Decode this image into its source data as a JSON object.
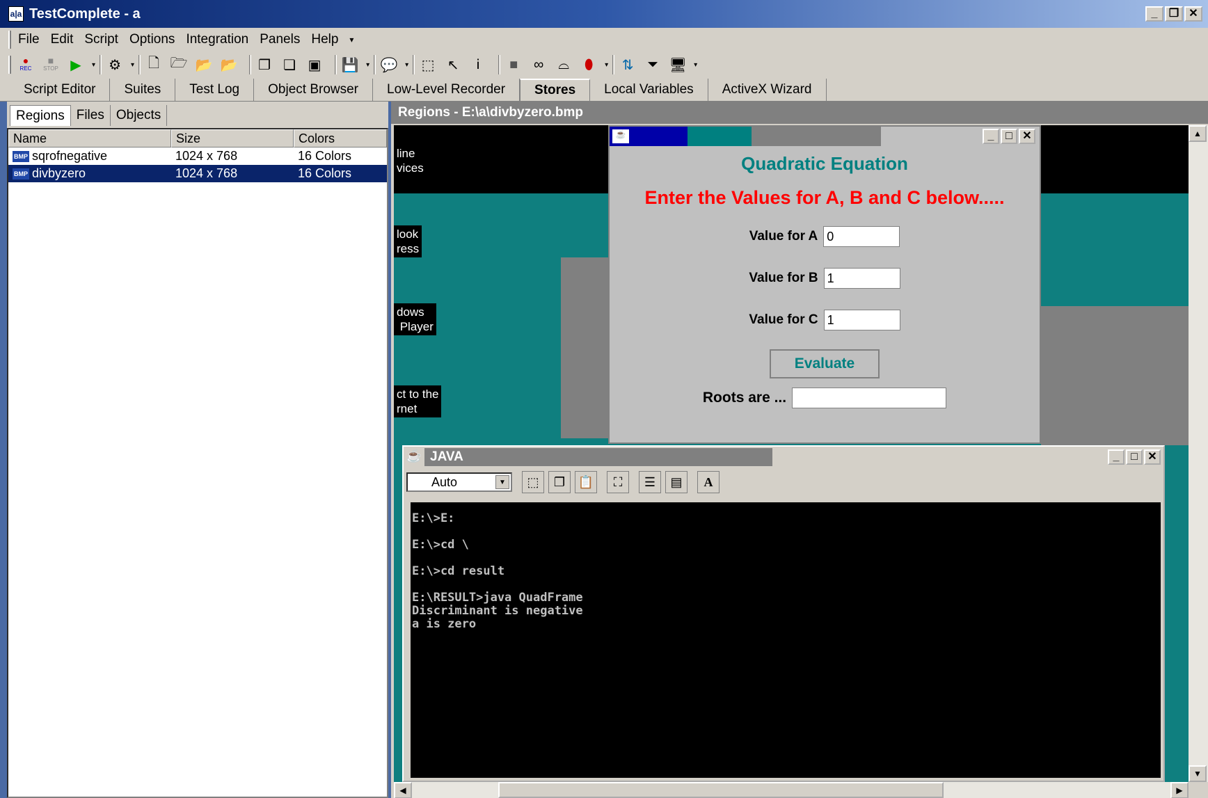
{
  "window": {
    "title": "TestComplete - a",
    "app_icon_text": "a|a"
  },
  "menu": [
    "File",
    "Edit",
    "Script",
    "Options",
    "Integration",
    "Panels",
    "Help"
  ],
  "toolbar": {
    "icons": [
      "record-icon",
      "stop-icon",
      "run-icon",
      "tools-icon",
      "new-icon",
      "open-icon",
      "add-icon",
      "import-icon",
      "copy-icon",
      "paste-icon",
      "window-icon",
      "save-icon",
      "comment-icon",
      "cursor-icon",
      "pointer-icon",
      "text-icon",
      "block-icon",
      "binoculars-icon",
      "glasses-icon",
      "pill-icon",
      "refresh-icon",
      "filter-icon",
      "monitor-icon"
    ],
    "rec_label": "REC",
    "stop_label": "STOP"
  },
  "tabs": [
    "Script Editor",
    "Suites",
    "Test Log",
    "Object Browser",
    "Low-Level Recorder",
    "Stores",
    "Local Variables",
    "ActiveX Wizard"
  ],
  "active_tab": "Stores",
  "left": {
    "subtabs": [
      "Regions",
      "Files",
      "Objects"
    ],
    "columns": [
      "Name",
      "Size",
      "Colors"
    ],
    "rows": [
      {
        "name": "sqrofnegative",
        "size": "1024 x 768",
        "colors": "16 Colors"
      },
      {
        "name": "divbyzero",
        "size": "1024 x 768",
        "colors": "16 Colors"
      }
    ],
    "bmp_label": "BMP"
  },
  "right": {
    "title": "Regions - E:\\a\\divbyzero.bmp",
    "desktop_labels": [
      "line\nvices",
      "look\nress",
      "dows\n Player",
      "ct to the\nrnet"
    ],
    "quad": {
      "heading": "Quadratic Equation",
      "prompt": "Enter the Values for A, B and C below.....",
      "fields": [
        {
          "label": "Value for A",
          "value": "0"
        },
        {
          "label": "Value for B",
          "value": "1"
        },
        {
          "label": "Value for C",
          "value": "1"
        }
      ],
      "button": "Evaluate",
      "roots_label": "Roots are ...",
      "roots_value": ""
    },
    "java": {
      "title": "JAVA",
      "font_select": "Auto",
      "console": "E:\\>E:\n\nE:\\>cd \\\n\nE:\\>cd result\n\nE:\\RESULT>java QuadFrame\nDiscriminant is negative\na is zero"
    }
  },
  "colors": {
    "titlebar": "#08246b",
    "selection": "#0a246a",
    "teal": "#008080",
    "red": "#ff0000"
  }
}
